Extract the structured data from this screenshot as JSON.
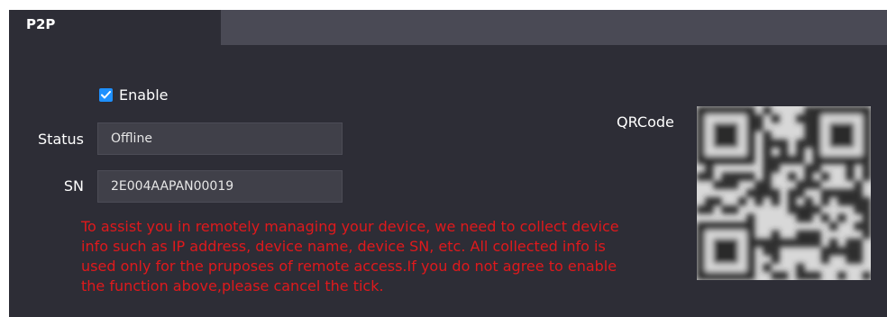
{
  "tab": {
    "label": "P2P"
  },
  "enable": {
    "label": "Enable",
    "checked": true
  },
  "status": {
    "label": "Status",
    "value": "Offline"
  },
  "sn": {
    "label": "SN",
    "value": "2E004AAPAN00019"
  },
  "qr": {
    "label": "QRCode",
    "icon": "qr-code-icon"
  },
  "notice": {
    "text": "To assist you in remotely managing your device, we need to collect device\ninfo such as IP address, device name, device SN, etc. All collected info is\nused only for the pruposes of remote access.If you do not agree to enable\nthe function above,please cancel the tick."
  },
  "colors": {
    "accent": "#1e90ff",
    "warning": "#e0191c",
    "panel": "#2d2d36"
  }
}
